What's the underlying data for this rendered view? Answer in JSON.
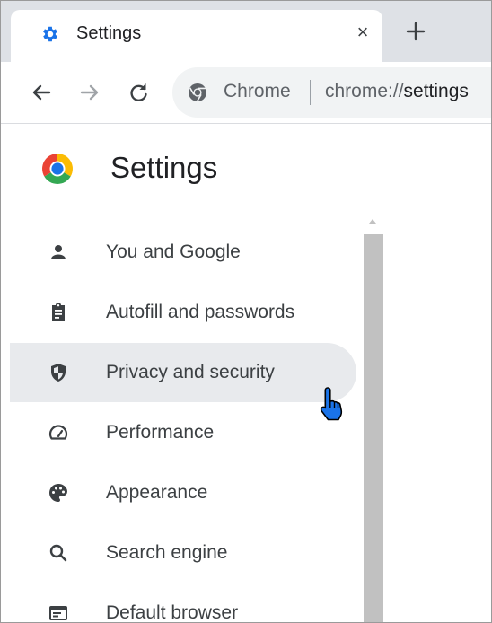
{
  "browser": {
    "tab": {
      "title": "Settings",
      "close_glyph": "×",
      "favicon": "gear-icon"
    },
    "new_tab_glyph": "+",
    "nav": {
      "back": "arrow-left-icon",
      "forward": "arrow-right-icon",
      "reload": "reload-icon"
    },
    "omnibox": {
      "chip": "Chrome",
      "url_scheme": "chrome://",
      "url_host": "settings"
    }
  },
  "page": {
    "title": "Settings",
    "logo": "chrome-logo"
  },
  "sidebar": {
    "items": [
      {
        "label": "You and Google",
        "icon": "person-icon",
        "active": false
      },
      {
        "label": "Autofill and passwords",
        "icon": "clipboard-icon",
        "active": false
      },
      {
        "label": "Privacy and security",
        "icon": "shield-icon",
        "active": true
      },
      {
        "label": "Performance",
        "icon": "speedometer-icon",
        "active": false
      },
      {
        "label": "Appearance",
        "icon": "palette-icon",
        "active": false
      },
      {
        "label": "Search engine",
        "icon": "search-icon",
        "active": false
      },
      {
        "label": "Default browser",
        "icon": "browser-window-icon",
        "active": false
      }
    ]
  },
  "colors": {
    "accent": "#1a73e8",
    "tab_strip": "#dee1e6",
    "active_item": "#e8eaed"
  }
}
